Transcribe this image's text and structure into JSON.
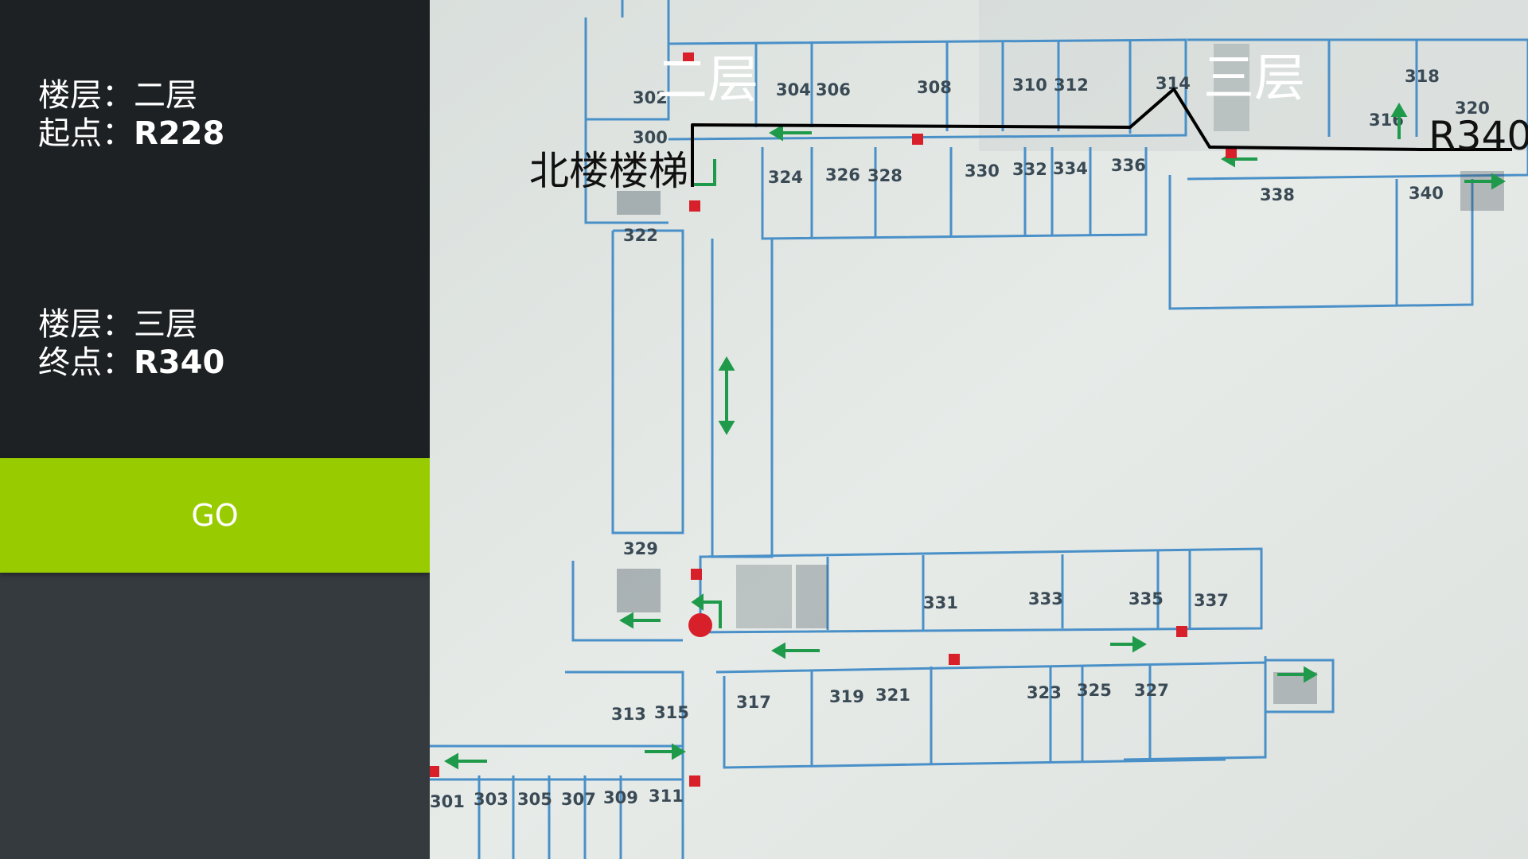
{
  "start": {
    "floor_label": "楼层：",
    "floor_value": "二层",
    "point_label": "起点：",
    "point_value": "R228"
  },
  "end": {
    "floor_label": "楼层：",
    "floor_value": "三层",
    "point_label": "终点：",
    "point_value": "R340"
  },
  "go_label": "GO",
  "map": {
    "floor_from_label": "二层",
    "floor_to_label": "三层",
    "stair_label": "北楼楼梯",
    "destination_label": "R340",
    "rooms_north": [
      "302",
      "300",
      "304",
      "306",
      "308",
      "310",
      "312",
      "314",
      "318",
      "320",
      "316"
    ],
    "rooms_corridor": [
      "324",
      "326",
      "328",
      "330",
      "332",
      "334",
      "336",
      "338",
      "340",
      "322"
    ],
    "rooms_middle": [
      "329",
      "331",
      "333",
      "335",
      "337"
    ],
    "rooms_south": [
      "313",
      "315",
      "317",
      "319",
      "321",
      "323",
      "325",
      "327"
    ],
    "rooms_bottom": [
      "301",
      "303",
      "305",
      "307",
      "309",
      "311"
    ],
    "route_color": "#000000",
    "plan_line_color": "#4a90c8",
    "arrow_color": "#1f9a4a",
    "marker_color": "#d8202a"
  }
}
